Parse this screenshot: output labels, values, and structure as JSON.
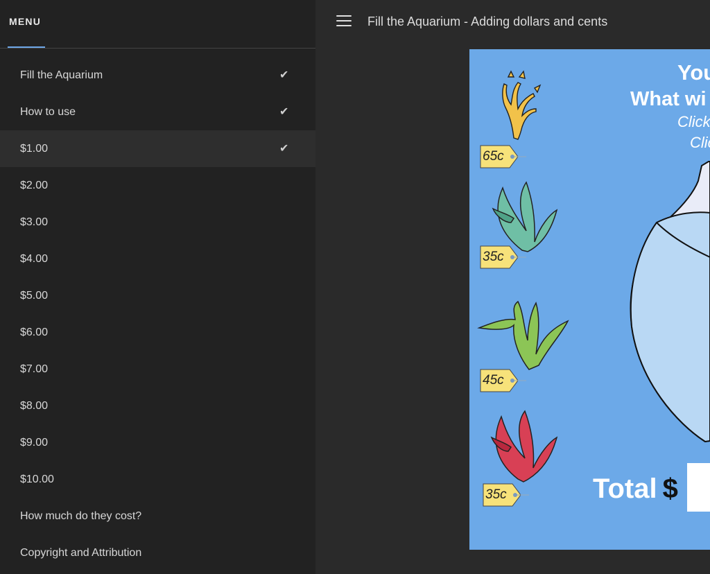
{
  "sidebar": {
    "menu_label": "MENU",
    "items": [
      {
        "label": "Fill the Aquarium",
        "checked": true
      },
      {
        "label": "How to use",
        "checked": true
      },
      {
        "label": "$1.00",
        "checked": true
      },
      {
        "label": "$2.00",
        "checked": false
      },
      {
        "label": "$3.00",
        "checked": false
      },
      {
        "label": "$4.00",
        "checked": false
      },
      {
        "label": "$5.00",
        "checked": false
      },
      {
        "label": "$6.00",
        "checked": false
      },
      {
        "label": "$7.00",
        "checked": false
      },
      {
        "label": "$8.00",
        "checked": false
      },
      {
        "label": "$9.00",
        "checked": false
      },
      {
        "label": "$10.00",
        "checked": false
      },
      {
        "label": "How much do they cost?",
        "checked": false
      },
      {
        "label": "Copyright and Attribution",
        "checked": false
      }
    ],
    "active_index": 2,
    "check_glyph": "✔"
  },
  "header": {
    "title": "Fill the Aquarium - Adding dollars and cents",
    "menu_icon": "hamburger-icon"
  },
  "slide": {
    "line1": "You",
    "line2": "What wi",
    "line3": "Click",
    "line4": "Clic",
    "total_label": "Total",
    "total_symbol": "$",
    "plants": [
      {
        "name": "yellow-coral",
        "price": "65c"
      },
      {
        "name": "teal-seaweed",
        "price": "35c"
      },
      {
        "name": "green-seaweed",
        "price": "45c"
      },
      {
        "name": "red-seaweed",
        "price": "35c"
      }
    ],
    "colors": {
      "background": "#6ca9e8",
      "tag": "#f7e27a",
      "bowl_glass": "#e9ecf8",
      "water": "#b9d8f4"
    }
  }
}
